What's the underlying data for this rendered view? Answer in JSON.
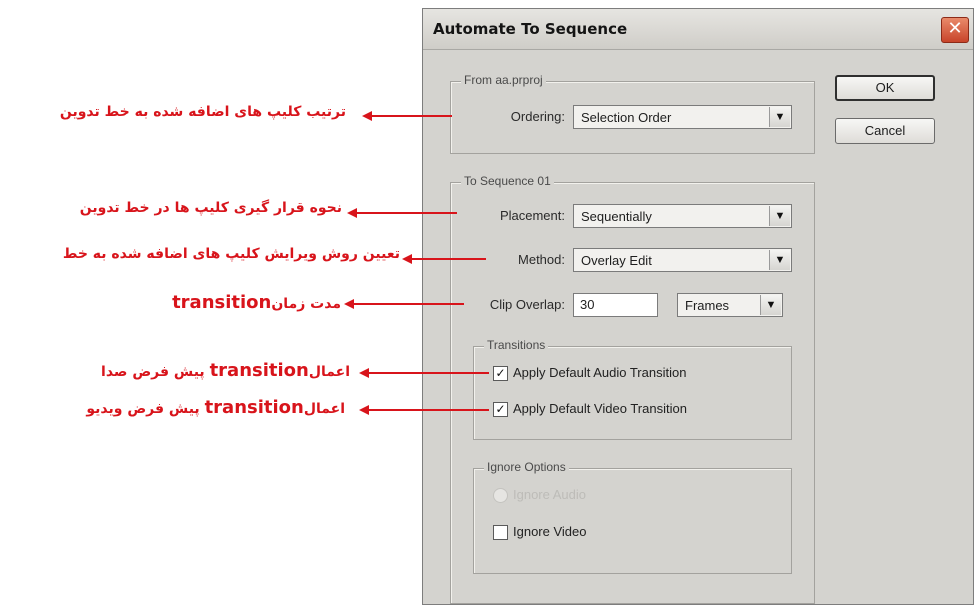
{
  "dialog": {
    "title": "Automate To Sequence",
    "close_symbol": "✕",
    "ok_label": "OK",
    "cancel_label": "Cancel",
    "from_group": {
      "legend": "From aa.prproj",
      "ordering_label": "Ordering:",
      "ordering_value": "Selection Order"
    },
    "to_group": {
      "legend": "To Sequence 01",
      "placement_label": "Placement:",
      "placement_value": "Sequentially",
      "method_label": "Method:",
      "method_value": "Overlay Edit",
      "clip_overlap_label": "Clip Overlap:",
      "clip_overlap_value": "30",
      "clip_overlap_unit": "Frames",
      "transitions": {
        "legend": "Transitions",
        "audio_label": "Apply Default Audio Transition",
        "audio_checked": true,
        "video_label": "Apply Default Video Transition",
        "video_checked": true
      },
      "ignore_options": {
        "legend": "Ignore Options",
        "ignore_audio_label": "Ignore Audio",
        "ignore_video_label": "Ignore Video",
        "ignore_video_checked": false
      }
    }
  },
  "annotations": [
    {
      "text": "ترتیب کلیپ های اضافه شده به خط تدوین"
    },
    {
      "text": "نحوه قرار گیری کلیپ ها در خط تدوین"
    },
    {
      "text": "تعیین روش ویرایش کلیپ های اضافه شده به خط"
    },
    {
      "text_prefix": "مدت زمان",
      "text_highlight": "transition"
    },
    {
      "text_prefix": "اعمال",
      "text_highlight": "transition",
      "text_suffix": " پیش فرض صدا"
    },
    {
      "text_prefix": "اعمال",
      "text_highlight": "transition",
      "text_suffix": " پیش فرض ویدیو"
    }
  ],
  "colors": {
    "annotation": "#d8141b",
    "dialog_bg": "#d4d3cf"
  }
}
